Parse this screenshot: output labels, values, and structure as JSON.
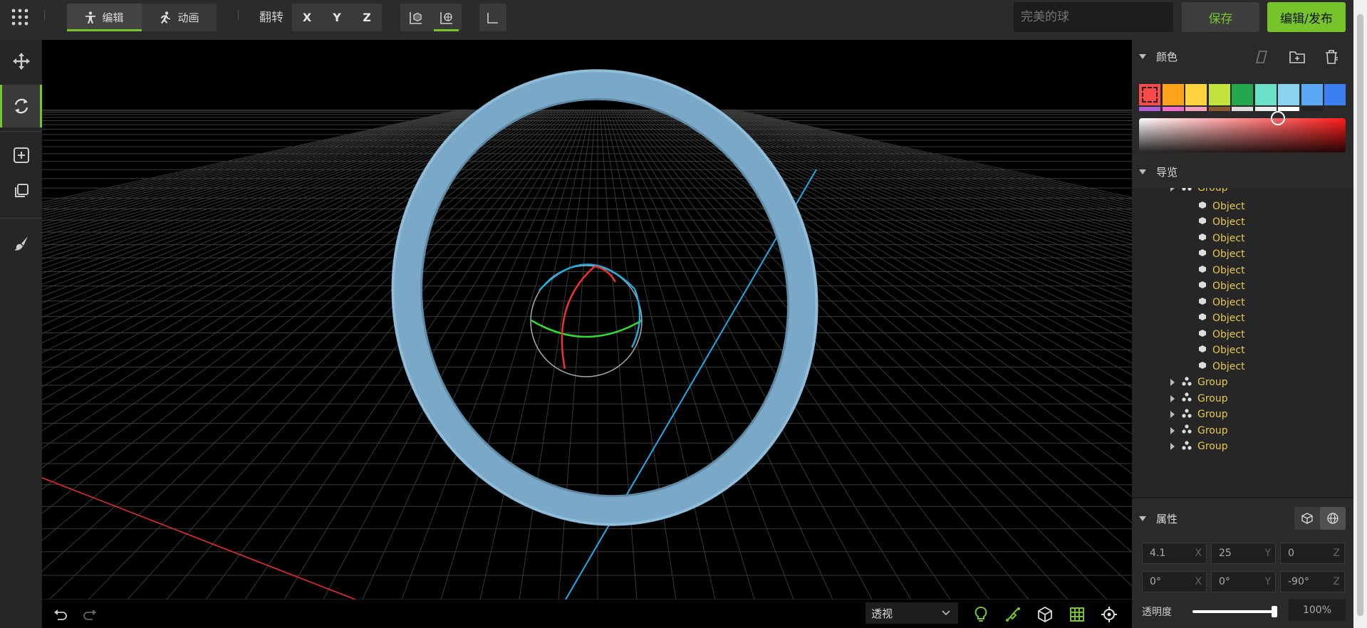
{
  "toolbar": {
    "modes": [
      {
        "label": "编辑",
        "icon": "person-icon",
        "active": true
      },
      {
        "label": "动画",
        "icon": "running-person-icon",
        "active": false
      }
    ],
    "flip_label": "翻转",
    "axes": [
      "X",
      "Y",
      "Z"
    ],
    "view_buttons": [
      {
        "icon": "cube-front-icon",
        "active": false
      },
      {
        "icon": "grid-floor-icon",
        "active": true
      }
    ],
    "corner_icon": "axis-corner-icon",
    "name_input": {
      "value": "",
      "placeholder": "完美的球"
    },
    "save_label": "保存",
    "publish_label": "编辑/发布"
  },
  "left_tools": [
    {
      "name": "move-tool",
      "icon": "move-arrows-icon",
      "active": false
    },
    {
      "name": "rotate-tool",
      "icon": "rotate-icon",
      "active": true
    },
    {
      "name": "add-tool",
      "icon": "add-square-icon",
      "active": false
    },
    {
      "name": "duplicate-tool",
      "icon": "duplicate-icon",
      "active": false
    },
    {
      "name": "paint-tool",
      "icon": "brush-icon",
      "active": false
    }
  ],
  "viewport": {
    "projection": "透视",
    "bottom_icons": [
      "undo-icon",
      "redo-icon",
      "lightbulb-icon",
      "pen-tool-icon",
      "cube-icon",
      "grid-icon",
      "target-icon"
    ]
  },
  "panel": {
    "color": {
      "title": "颜色",
      "swatches": [
        "#ff4a4a",
        "#ffa31a",
        "#ffd23f",
        "#c1e33b",
        "#22a84a",
        "#6be0c8",
        "#8ad4f2",
        "#5aa8f5",
        "#3d7ef0"
      ],
      "swatches_row2": [
        "#b05ed6",
        "#f06ec8",
        "#f2a0c0",
        "#8a5a2e",
        "#dddddd",
        "#eeeeee",
        "#ffffff",
        "#222222",
        "#2b2b2b"
      ]
    },
    "nav": {
      "title": "导览",
      "partial_top": "Group",
      "objects": [
        "Object",
        "Object",
        "Object",
        "Object",
        "Object",
        "Object",
        "Object",
        "Object",
        "Object",
        "Object",
        "Object"
      ],
      "groups": [
        "Group",
        "Group",
        "Group",
        "Group"
      ]
    },
    "props": {
      "title": "属性",
      "position": [
        {
          "v": "4.1",
          "a": "X"
        },
        {
          "v": "25",
          "a": "Y"
        },
        {
          "v": "0",
          "a": "Z"
        }
      ],
      "rotation": [
        {
          "v": "0°",
          "a": "X"
        },
        {
          "v": "0°",
          "a": "Y"
        },
        {
          "v": "-90°",
          "a": "Z"
        }
      ],
      "opacity_label": "透明度",
      "opacity_value": "100%",
      "opacity_fraction": 1.0
    }
  }
}
